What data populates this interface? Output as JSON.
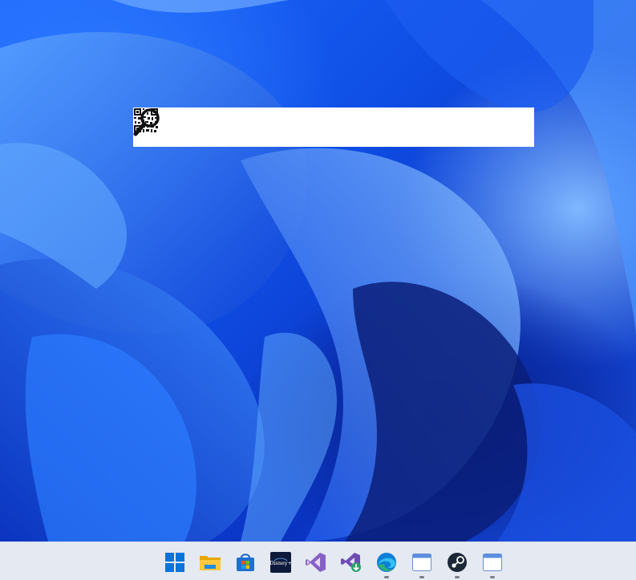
{
  "desktop": {
    "wallpaper": "windows-11-bloom",
    "colors": {
      "deep": "#0a2aa0",
      "mid": "#1f6bff",
      "light": "#7fb7ff"
    }
  },
  "search_bar": {
    "value": "",
    "placeholder": "",
    "qr_icon": "qr-code-icon",
    "search_icon": "magnifier-icon"
  },
  "taskbar": {
    "background": "#e4e9f2",
    "items": [
      {
        "icon": "windows-start-icon",
        "running": false
      },
      {
        "icon": "file-explorer-icon",
        "running": false
      },
      {
        "icon": "microsoft-store-icon",
        "running": false
      },
      {
        "icon": "disney-plus-icon",
        "label": "Disney+",
        "running": false
      },
      {
        "icon": "visual-studio-icon",
        "running": false
      },
      {
        "icon": "visual-studio-installer-icon",
        "running": false
      },
      {
        "icon": "edge-browser-icon",
        "running": true
      },
      {
        "icon": "window-app-icon",
        "running": true
      },
      {
        "icon": "steam-icon",
        "running": true
      },
      {
        "icon": "window-app-icon",
        "running": true
      }
    ]
  }
}
